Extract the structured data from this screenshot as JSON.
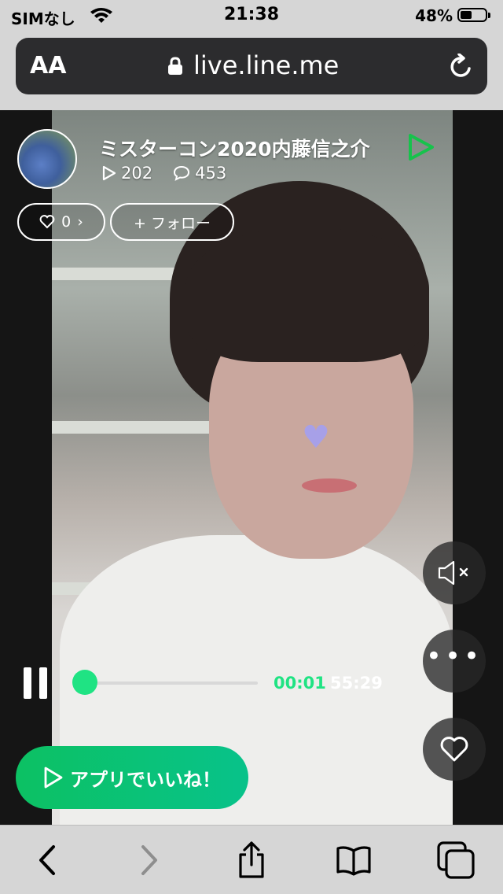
{
  "status_bar": {
    "carrier": "SIMなし",
    "time": "21:38",
    "battery_percent": "48%",
    "battery_level": 0.48
  },
  "browser": {
    "text_size_label": "AA",
    "url": "live.line.me"
  },
  "channel": {
    "title": "ミスターコン2020内藤信之介",
    "play_count": "202",
    "comment_count": "453"
  },
  "actions": {
    "like_count": "0",
    "like_chevron": "›",
    "follow_label": "+ フォロー",
    "app_like_label": "アプリでいいね！"
  },
  "player": {
    "current_time": "00:01",
    "total_time": "55:29",
    "progress": 0.0
  },
  "colors": {
    "accent_green": "#1fe383",
    "button_green": "#0cc163"
  },
  "icons": {
    "mute": "speaker-muted-icon",
    "more": "ellipsis-icon",
    "heart": "heart-outline-icon",
    "pause": "pause-icon"
  }
}
